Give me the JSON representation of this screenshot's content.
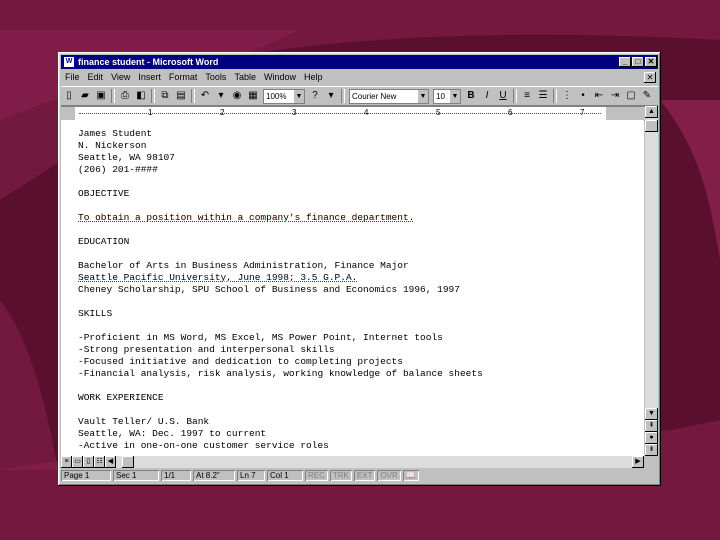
{
  "window": {
    "title": "finance student - Microsoft Word"
  },
  "menu": [
    "File",
    "Edit",
    "View",
    "Insert",
    "Format",
    "Tools",
    "Table",
    "Window",
    "Help"
  ],
  "toolbar": {
    "zoom": "100%",
    "font": "Courier New",
    "font_size": "10"
  },
  "ruler": {
    "numbers": [
      "1",
      "2",
      "3",
      "4",
      "5",
      "6",
      "7"
    ]
  },
  "document": {
    "lines": [
      "James Student",
      "N. Nickerson",
      "Seattle, WA 98107",
      "(206) 201-####",
      "OBJECTIVE",
      "To obtain a position within a company's finance department.",
      "EDUCATION",
      "Bachelor of Arts in Business Administration, Finance Major",
      "Seattle Pacific University, June 1998; 3.5 G.P.A.",
      "Cheney Scholarship, SPU School of Business and Economics 1996, 1997",
      "SKILLS",
      "-Proficient in MS Word, MS Excel, MS Power Point, Internet tools",
      "-Strong presentation and interpersonal skills",
      "-Focused initiative and dedication to completing projects",
      "-Financial analysis, risk analysis, working knowledge of balance sheets",
      "WORK EXPERIENCE",
      "Vault Teller/ U.S. Bank",
      "Seattle, WA: Dec. 1997 to current",
      "-Active in one-on-one customer service roles"
    ]
  },
  "status": {
    "page": "Page 1",
    "sec": "Sec 1",
    "pages": "1/1",
    "at": "At 8.2\"",
    "ln": "Ln 7",
    "col": "Col 1",
    "rec": "REC",
    "trk": "TRK",
    "ext": "EXT",
    "ovr": "OVR"
  }
}
